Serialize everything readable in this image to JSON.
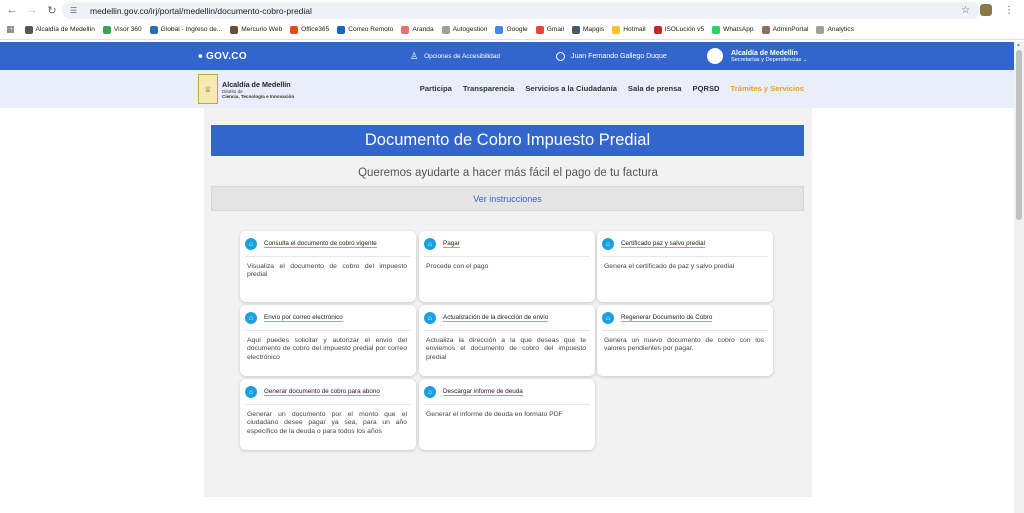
{
  "browser": {
    "url": "medellin.gov.co/irj/portal/medellin/documento-cobro-predial",
    "bookmarks": [
      {
        "label": "Alcaldía de Medellín",
        "color": "#555555"
      },
      {
        "label": "Visor 360",
        "color": "#3aa356"
      },
      {
        "label": "Global - Ingreso de...",
        "color": "#2a6fb5"
      },
      {
        "label": "Mercurio Web",
        "color": "#6d4c41"
      },
      {
        "label": "Office365",
        "color": "#e64a19"
      },
      {
        "label": "Correo Remoto",
        "color": "#1565c0"
      },
      {
        "label": "Aranda",
        "color": "#e57373"
      },
      {
        "label": "Autogestion",
        "color": "#9e9e9e"
      },
      {
        "label": "Google",
        "color": "#4285f4"
      },
      {
        "label": "Gmail",
        "color": "#ea4335"
      },
      {
        "label": "Mapgis",
        "color": "#455a64"
      },
      {
        "label": "Hotmail",
        "color": "#fbc02d"
      },
      {
        "label": "ISOLución v5",
        "color": "#c62828"
      },
      {
        "label": "WhatsApp",
        "color": "#25d366"
      },
      {
        "label": "AdminPortal",
        "color": "#8d6e63"
      },
      {
        "label": "Analytics",
        "color": "#9e9e9e"
      }
    ]
  },
  "govbar": {
    "logo": "GOV.CO",
    "accessibility": "Opciones de Accesibilidad",
    "user_name": "Juan Fernando Gallego Duque",
    "alcaldia_title": "Alcaldía de Medellín",
    "alcaldia_sub": "Secretarías y Dependencias"
  },
  "site": {
    "brand_title": "Alcaldía de Medellín",
    "brand_sub1": "Distrito de",
    "brand_sub2": "Ciencia, Tecnología e Innovación",
    "menu": [
      "Participa",
      "Transparencia",
      "Servicios a la Ciudadanía",
      "Sala de prensa",
      "PQRSD",
      "Trámites y Servicios"
    ]
  },
  "main": {
    "title": "Documento de Cobro Impuesto Predial",
    "subtitle": "Queremos ayudarte a hacer más fácil el pago de tu factura",
    "instructions": "Ver instrucciones",
    "cards": [
      {
        "title": "Consulta el documento de cobro vigente",
        "desc": "Visualiza el documento de cobro del impuesto predial"
      },
      {
        "title": "Pagar",
        "desc": "Procede con el pago"
      },
      {
        "title": "Certificado paz y salvo predial",
        "desc": "Genera el certificado de paz y salvo predial"
      },
      {
        "title": "Envío por correo electrónico",
        "desc": "Aquí puedes solicitar y autorizar el envío del documento de cobro del impuesto predial por correo electrónico"
      },
      {
        "title": "Actualización de la dirección de envío",
        "desc": "Actualiza la dirección a la que deseas que te enviemos el documento de cobro del impuesto predial"
      },
      {
        "title": "Regenerar Documento de Cobro",
        "desc": "Genera un nuevo documento de cobro con los valores pendientes por pagar."
      },
      {
        "title": "Generar documento de cobro para abono",
        "desc": "Generar un documento por el monto que el ciudadano desee pagar ya sea, para un año específico de la deuda o para todos los años"
      },
      {
        "title": "Descargar informe de deuda",
        "desc": "Generar el informe de deuda en formato PDF"
      }
    ]
  },
  "colors": {
    "gov_blue": "#3366cc",
    "accent_orange": "#f39c12",
    "card_icon": "#1aa0e0"
  }
}
